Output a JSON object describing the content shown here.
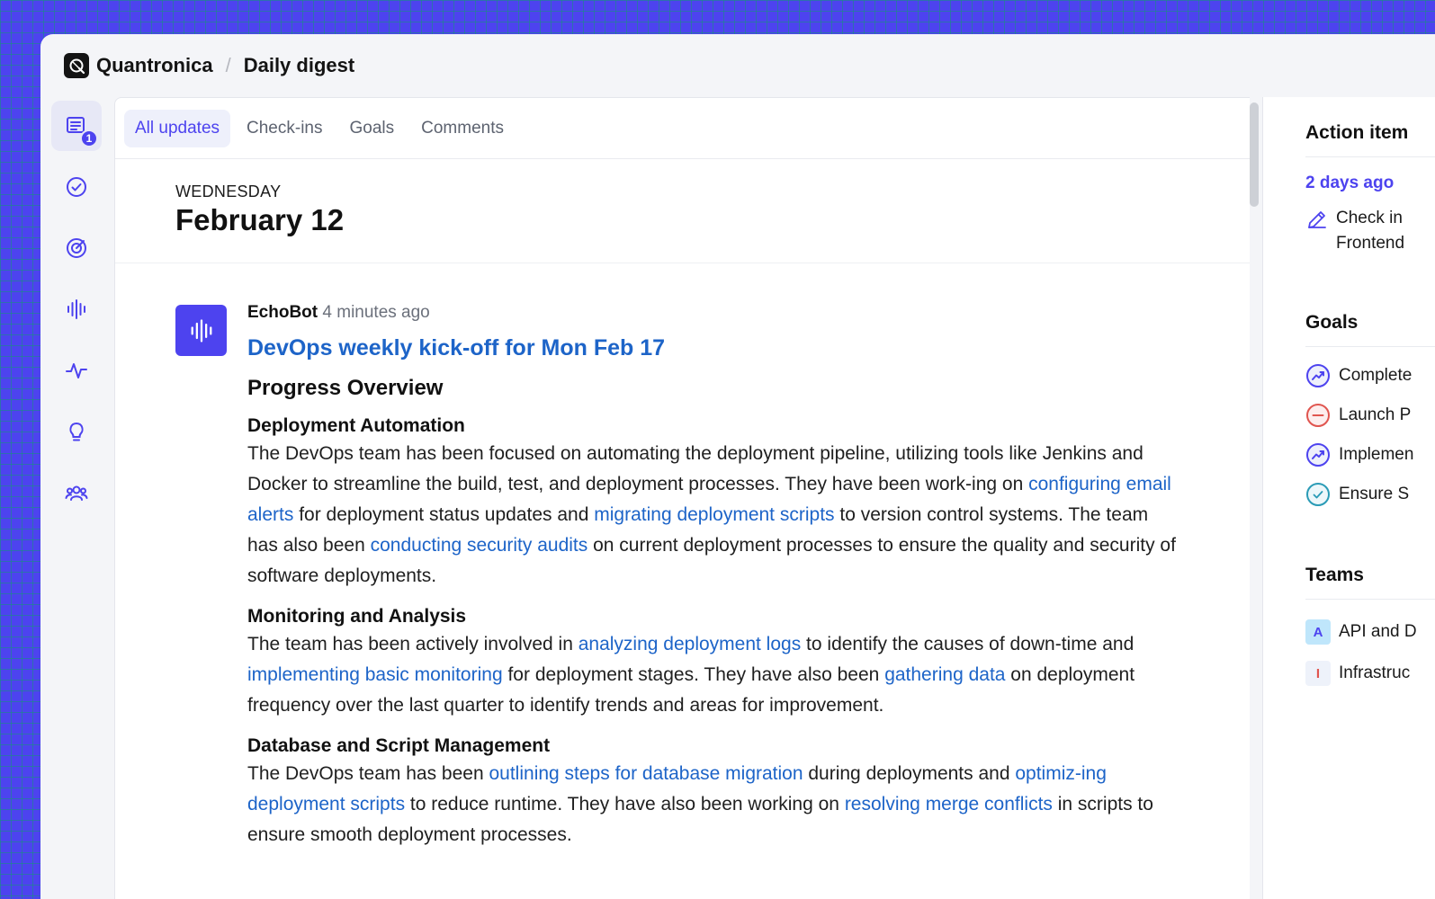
{
  "app": {
    "brand": "Quantronica",
    "page": "Daily digest"
  },
  "rail": {
    "badge": "1"
  },
  "tabs": [
    "All updates",
    "Check-ins",
    "Goals",
    "Comments"
  ],
  "day": {
    "weekday": "WEDNESDAY",
    "date": "February 12"
  },
  "post": {
    "author": "EchoBot",
    "time": "4 minutes ago",
    "title": "DevOps weekly kick-off for Mon Feb 17",
    "overview": "Progress Overview",
    "s1": {
      "title": "Deployment Automation",
      "t1": "The DevOps team has been focused on automating the deployment pipeline, utilizing tools like Jenkins and Docker to streamline the build, test, and deployment processes. They have been work-ing on ",
      "l1": "configuring email alerts",
      "t2": " for deployment status updates and ",
      "l2": "migrating deployment scripts",
      "t3": " to version control systems. The team has also been ",
      "l3": "conducting security audits",
      "t4": " on current deployment processes to ensure the quality and security of software deployments."
    },
    "s2": {
      "title": "Monitoring and Analysis",
      "t1": "The team has been actively involved in ",
      "l1": "analyzing deployment logs",
      "t2": " to identify the causes of down-time and ",
      "l2": "implementing basic monitoring",
      "t3": " for deployment stages. They have also been ",
      "l3": "gathering data",
      "t4": " on deployment frequency over the last quarter to identify trends and areas for improvement."
    },
    "s3": {
      "title": "Database and Script Management",
      "t1": "The DevOps team has been ",
      "l1": "outlining steps for database migration",
      "t2": " during deployments and ",
      "l2": "optimiz-ing deployment scripts",
      "t3": " to reduce runtime. They have also been working on ",
      "l3": "resolving merge conflicts",
      "t4": " in scripts to ensure smooth deployment processes."
    }
  },
  "sidebar": {
    "action_title": "Action item",
    "action_when": "2 days ago",
    "action_line1": "Check in",
    "action_line2": "Frontend",
    "goals_title": "Goals",
    "goals": [
      "Complete",
      "Launch P",
      "Implemen",
      "Ensure S"
    ],
    "teams_title": "Teams",
    "teams": [
      {
        "initial": "A",
        "name": "API and D"
      },
      {
        "initial": "I",
        "name": "Infrastruc"
      }
    ]
  },
  "colors": {
    "accent": "#4d43ef",
    "link": "#1d64c8",
    "goal_off_track": "#e0554f",
    "goal_done": "#2a9bb6"
  }
}
